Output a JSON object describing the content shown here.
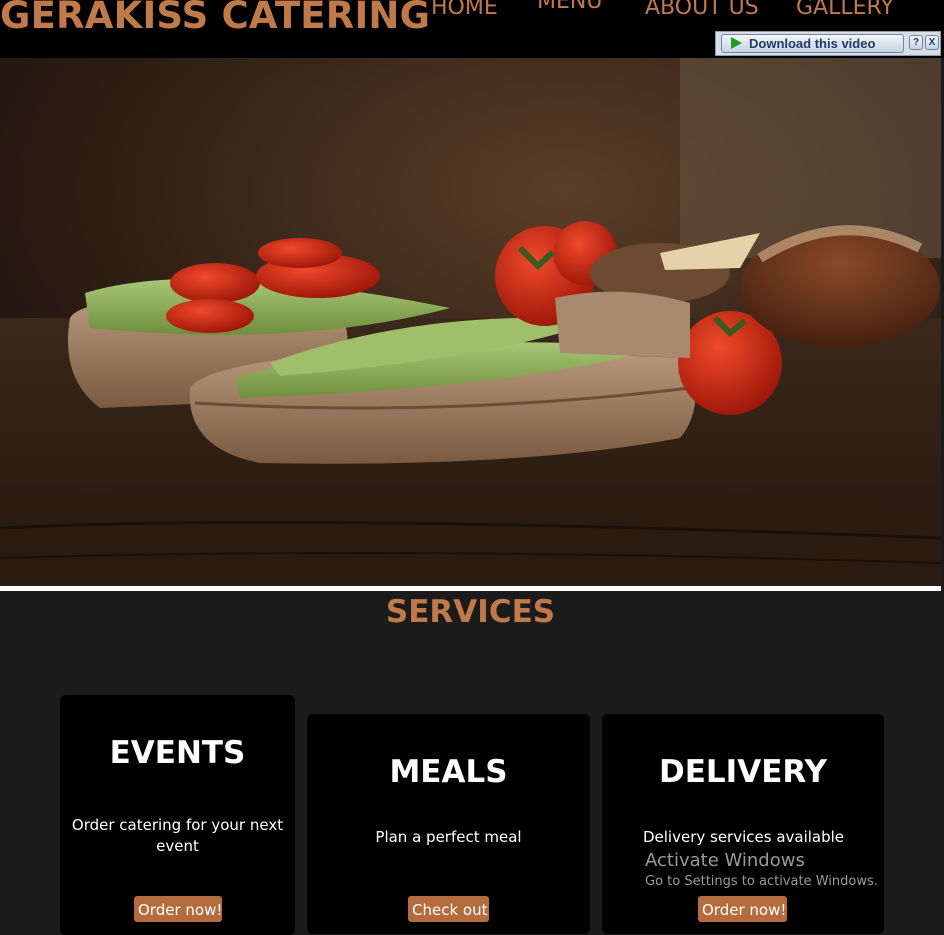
{
  "brand": "GERAKISS CATERING",
  "nav": {
    "home": "HOME",
    "menu": "MENU",
    "about": "ABOUT US",
    "gallery": "GALLERY"
  },
  "download_bar": {
    "button_label": "Download this video",
    "help": "?",
    "close": "X"
  },
  "services": {
    "title": "SERVICES",
    "cards": [
      {
        "title": "EVENTS",
        "text": "Order catering for your next event",
        "button": "Order now!"
      },
      {
        "title": "MEALS",
        "text": "Plan a perfect meal",
        "button": "Check out"
      },
      {
        "title": "DELIVERY",
        "text": "Delivery services available",
        "button": "Order now!"
      }
    ]
  },
  "activation_notice": {
    "title": "Activate Windows",
    "subtitle": "Go to Settings to activate Windows."
  },
  "colors": {
    "accent": "#c07a4a",
    "button": "#b46c3f",
    "background": "#1b1b1b",
    "card": "#000000"
  }
}
